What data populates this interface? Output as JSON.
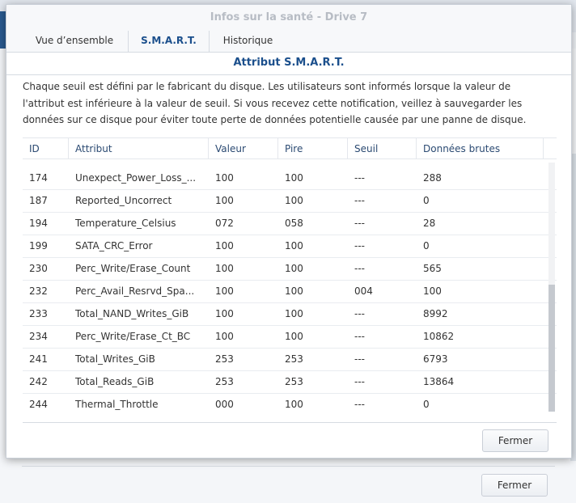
{
  "window": {
    "title": "Infos sur la santé - Drive 7"
  },
  "tabs": [
    {
      "label": "Vue d’ensemble"
    },
    {
      "label": "S.M.A.R.T."
    },
    {
      "label": "Historique"
    }
  ],
  "section": {
    "title": "Attribut S.M.A.R.T.",
    "description": "Chaque seuil est défini par le fabricant du disque. Les utilisateurs sont informés lorsque la valeur de l'attribut est inférieure à la valeur de seuil. Si vous recevez cette notification, veillez à sauvegarder les données sur ce disque pour éviter toute perte de données potentielle causée par une panne de disque."
  },
  "table": {
    "columns": [
      "ID",
      "Attribut",
      "Valeur",
      "Pire",
      "Seuil",
      "Données brutes"
    ],
    "rows": [
      {
        "id": "174",
        "attribute": "Unexpect_Power_Loss_...",
        "value": "100",
        "worst": "100",
        "threshold": "---",
        "raw": "288"
      },
      {
        "id": "187",
        "attribute": "Reported_Uncorrect",
        "value": "100",
        "worst": "100",
        "threshold": "---",
        "raw": "0"
      },
      {
        "id": "194",
        "attribute": "Temperature_Celsius",
        "value": "072",
        "worst": "058",
        "threshold": "---",
        "raw": "28"
      },
      {
        "id": "199",
        "attribute": "SATA_CRC_Error",
        "value": "100",
        "worst": "100",
        "threshold": "---",
        "raw": "0"
      },
      {
        "id": "230",
        "attribute": "Perc_Write/Erase_Count",
        "value": "100",
        "worst": "100",
        "threshold": "---",
        "raw": "565"
      },
      {
        "id": "232",
        "attribute": "Perc_Avail_Resrvd_Spa...",
        "value": "100",
        "worst": "100",
        "threshold": "004",
        "raw": "100"
      },
      {
        "id": "233",
        "attribute": "Total_NAND_Writes_GiB",
        "value": "100",
        "worst": "100",
        "threshold": "---",
        "raw": "8992"
      },
      {
        "id": "234",
        "attribute": "Perc_Write/Erase_Ct_BC",
        "value": "100",
        "worst": "100",
        "threshold": "---",
        "raw": "10862"
      },
      {
        "id": "241",
        "attribute": "Total_Writes_GiB",
        "value": "253",
        "worst": "253",
        "threshold": "---",
        "raw": "6793"
      },
      {
        "id": "242",
        "attribute": "Total_Reads_GiB",
        "value": "253",
        "worst": "253",
        "threshold": "---",
        "raw": "13864"
      },
      {
        "id": "244",
        "attribute": "Thermal_Throttle",
        "value": "000",
        "worst": "100",
        "threshold": "---",
        "raw": "0"
      }
    ]
  },
  "footer": {
    "close_label": "Fermer"
  },
  "background_window": {
    "close_label": "Fermer"
  },
  "colors": {
    "accent": "#1b4f8c",
    "title_muted": "#b7bcc4"
  }
}
